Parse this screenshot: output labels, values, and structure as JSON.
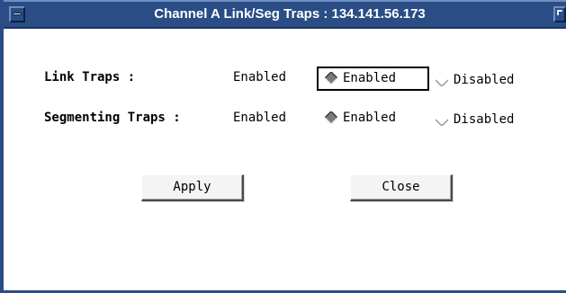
{
  "window": {
    "title": "Channel A Link/Seg Traps : 134.141.56.173"
  },
  "link_traps": {
    "label": "Link Traps :",
    "current_value": "Enabled",
    "options": [
      {
        "label": "Enabled",
        "selected": true
      },
      {
        "label": "Disabled",
        "selected": false
      }
    ]
  },
  "segmenting_traps": {
    "label": "Segmenting Traps :",
    "current_value": "Enabled",
    "options": [
      {
        "label": "Enabled",
        "selected": true
      },
      {
        "label": "Disabled",
        "selected": false
      }
    ]
  },
  "buttons": {
    "apply": "Apply",
    "close": "Close"
  },
  "colors": {
    "titlebar": "#2a4d86",
    "radio_selected": "#7a7a7a",
    "radio_unselected": "#ffffff"
  }
}
